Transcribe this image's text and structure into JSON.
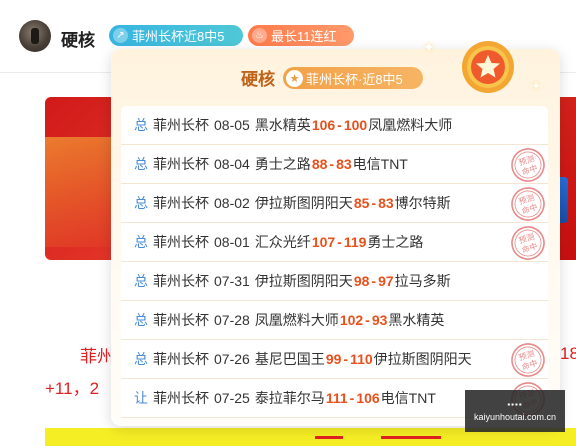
{
  "header": {
    "username": "硬核",
    "badges": [
      {
        "icon": "arrow-up-icon",
        "label": "菲州长杯近8中5"
      },
      {
        "icon": "flame-icon",
        "label": "最长11连红"
      }
    ]
  },
  "background": {
    "text_line_1": "菲州",
    "text_line_2": "+11，2",
    "text_right": "18"
  },
  "popup": {
    "title": "硬核",
    "badge_label": "菲州长杯·近8中5",
    "rows": [
      {
        "tag": "总",
        "league": "菲州长杯",
        "date": "08-05",
        "home": "黑水精英",
        "home_score": "106",
        "sep": " - ",
        "away_score": "100",
        "away": "凤凰燃料大师",
        "stamp": false
      },
      {
        "tag": "总",
        "league": "菲州长杯",
        "date": "08-04",
        "home": "勇士之路",
        "home_score": "88",
        "sep": " - ",
        "away_score": "83",
        "away": "电信TNT",
        "stamp": true
      },
      {
        "tag": "总",
        "league": "菲州长杯",
        "date": "08-02",
        "home": "伊拉斯图阴阳天",
        "home_score": "85",
        "sep": " - ",
        "away_score": "83",
        "away": "博尔特斯",
        "stamp": true
      },
      {
        "tag": "总",
        "league": "菲州长杯",
        "date": "08-01",
        "home": "汇众光纤",
        "home_score": "107",
        "sep": " - ",
        "away_score": "119",
        "away": "勇士之路",
        "stamp": true
      },
      {
        "tag": "总",
        "league": "菲州长杯",
        "date": "07-31",
        "home": "伊拉斯图阴阳天",
        "home_score": "98",
        "sep": " - ",
        "away_score": "97",
        "away": "拉马多斯",
        "stamp": false
      },
      {
        "tag": "总",
        "league": "菲州长杯",
        "date": "07-28",
        "home": "凤凰燃料大师",
        "home_score": "102",
        "sep": " - ",
        "away_score": "93",
        "away": "黑水精英",
        "stamp": false
      },
      {
        "tag": "总",
        "league": "菲州长杯",
        "date": "07-26",
        "home": "基尼巴国王",
        "home_score": "99",
        "sep": " - ",
        "away_score": "110",
        "away": "伊拉斯图阴阳天",
        "stamp": true
      },
      {
        "tag": "让",
        "league": "菲州长杯",
        "date": "07-25",
        "home": "泰拉菲尔马",
        "home_score": "111",
        "sep": " - ",
        "away_score": "106",
        "away": "电信TNT",
        "stamp": true
      }
    ],
    "stamp_text": [
      "预测",
      "命中"
    ]
  },
  "watermark": {
    "top": "▪▪▪▪",
    "url": "kaiyunhoutai.com.cn"
  },
  "colors": {
    "score": "#e8501c",
    "tag": "#4a8bd6",
    "title": "#c0631a",
    "stamp": "#e88a8a"
  }
}
